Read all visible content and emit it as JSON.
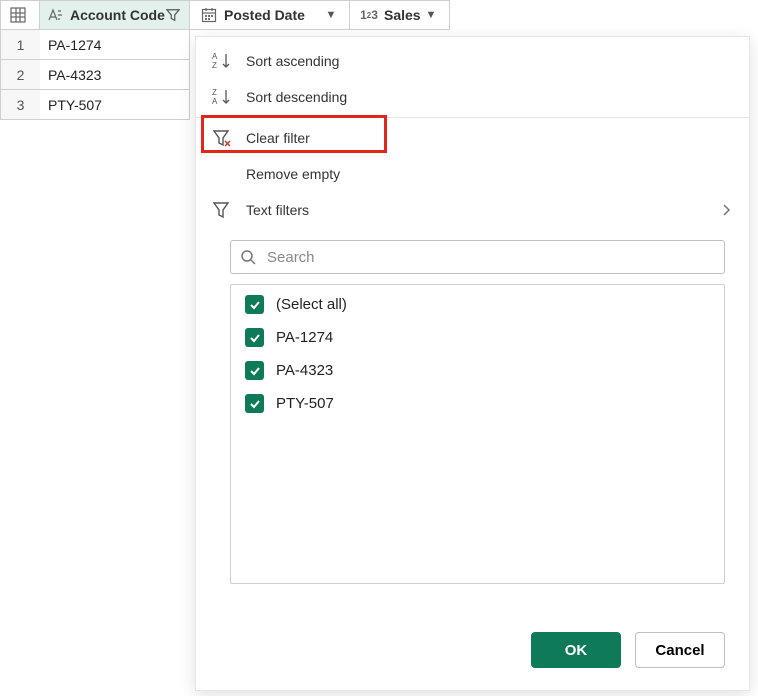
{
  "columns": {
    "account": "Account Code",
    "posted": "Posted Date",
    "sales": "Sales"
  },
  "rows": [
    {
      "n": "1",
      "account": "PA-1274"
    },
    {
      "n": "2",
      "account": "PA-4323"
    },
    {
      "n": "3",
      "account": "PTY-507"
    }
  ],
  "menu": {
    "sort_asc": "Sort ascending",
    "sort_desc": "Sort descending",
    "clear_filter": "Clear filter",
    "remove_empty": "Remove empty",
    "text_filters": "Text filters"
  },
  "search": {
    "placeholder": "Search"
  },
  "checklist": {
    "select_all": "(Select all)",
    "items": [
      "PA-1274",
      "PA-4323",
      "PTY-507"
    ]
  },
  "buttons": {
    "ok": "OK",
    "cancel": "Cancel"
  }
}
